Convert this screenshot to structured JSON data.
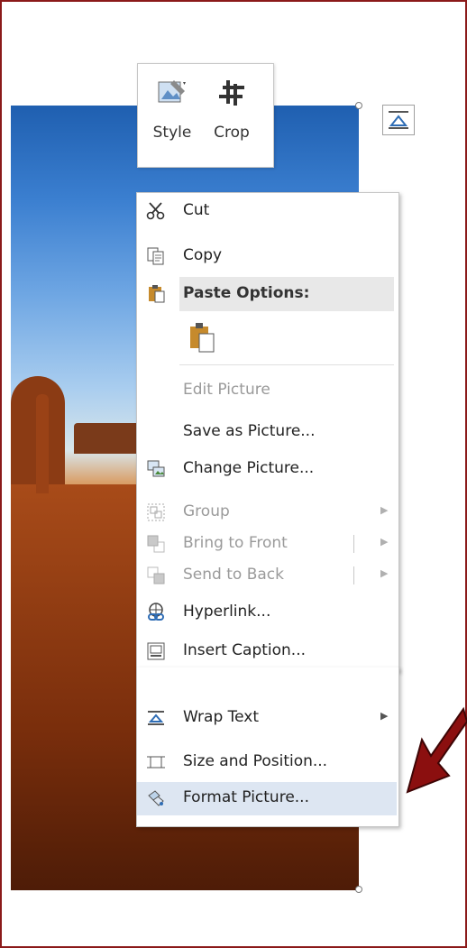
{
  "mini_toolbar": {
    "style_label": "Style",
    "crop_label": "Crop"
  },
  "menu": {
    "items": [
      {
        "label": "Cut",
        "icon": "scissors-icon",
        "enabled": true
      },
      {
        "label": "Copy",
        "icon": "copy-icon",
        "enabled": true
      },
      {
        "label": "Paste Options:",
        "icon": "paste-icon",
        "enabled": true
      },
      {
        "label": "Edit Picture",
        "icon": "",
        "enabled": false
      },
      {
        "label": "Save as Picture...",
        "icon": "",
        "enabled": true
      },
      {
        "label": "Change Picture...",
        "icon": "change-picture-icon",
        "enabled": true
      },
      {
        "label": "Group",
        "icon": "group-icon",
        "enabled": false,
        "submenu": true
      },
      {
        "label": "Bring to Front",
        "icon": "bring-front-icon",
        "enabled": false,
        "submenu": true
      },
      {
        "label": "Send to Back",
        "icon": "send-back-icon",
        "enabled": false,
        "submenu": true
      },
      {
        "label": "Hyperlink...",
        "icon": "hyperlink-icon",
        "enabled": true
      },
      {
        "label": "Insert Caption...",
        "icon": "caption-icon",
        "enabled": true
      },
      {
        "label": "Wrap Text",
        "icon": "wrap-text-icon",
        "enabled": true,
        "submenu": true
      },
      {
        "label": "Size and Position...",
        "icon": "size-position-icon",
        "enabled": true
      },
      {
        "label": "Format Picture...",
        "icon": "format-picture-icon",
        "enabled": true,
        "highlighted": true
      }
    ]
  },
  "colors": {
    "frame_border": "#8b1a1a",
    "highlight": "#dde6f2",
    "arrow": "#8b0f0f"
  }
}
